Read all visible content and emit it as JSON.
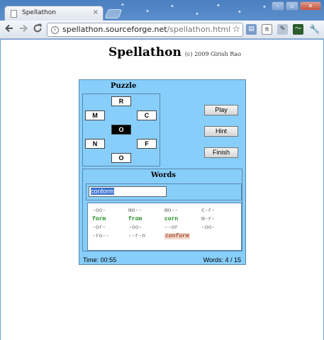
{
  "browser": {
    "tab_title": "Spellathon",
    "tab_close": "×",
    "url_host": "spellathon.sourceforge.net",
    "url_path": "/spellathon.html",
    "window_buttons": [
      "–",
      "▫",
      "✕"
    ]
  },
  "page": {
    "title": "Spellathon",
    "credit": "(c) 2009 Girish Rao"
  },
  "puzzle": {
    "heading": "Puzzle",
    "letters": {
      "top": "R",
      "left": "M",
      "right": "C",
      "center": "O",
      "bottom_left": "N",
      "bottom_right": "F",
      "bottom": "O"
    }
  },
  "buttons": {
    "play": "Play",
    "hint": "Hint",
    "finish": "Finish"
  },
  "words": {
    "heading": "Words",
    "input_value": "conform",
    "list": [
      [
        "-oo-",
        "mo--",
        "mo--",
        "c-r-"
      ],
      [
        "form",
        "from",
        "corn",
        "m-r-"
      ],
      [
        "-or-",
        "-oo-",
        "--or",
        "-oo-"
      ],
      [
        "-ro--",
        "--r-n",
        "conform",
        ""
      ]
    ],
    "found": [
      "form",
      "from",
      "corn"
    ],
    "last_found": "conform"
  },
  "status": {
    "time": "Time: 00:55",
    "count": "Words: 4 / 15"
  },
  "colors": {
    "panel": "#87cefa",
    "found": "#1b8a1b",
    "last": "#9c4c33"
  }
}
